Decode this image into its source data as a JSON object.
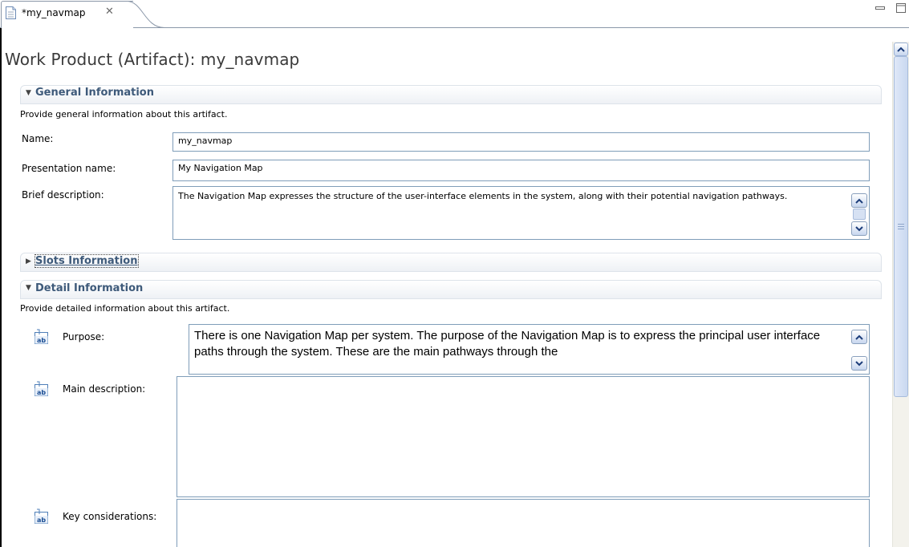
{
  "tab": {
    "label": "*my_navmap",
    "close": "✕"
  },
  "page": {
    "title": "Work Product (Artifact): my_navmap"
  },
  "general": {
    "title": "General Information",
    "description": "Provide general information about this artifact.",
    "name_label": "Name:",
    "name_value": "my_navmap",
    "presentation_label": "Presentation name:",
    "presentation_value": "My Navigation Map",
    "brief_label": "Brief description:",
    "brief_value": "The Navigation Map expresses the structure of the user-interface elements in the system, along with their potential navigation pathways."
  },
  "slots": {
    "title": "Slots Information"
  },
  "detail": {
    "title": "Detail Information",
    "description": "Provide detailed information about this artifact.",
    "purpose_label": "Purpose:",
    "purpose_value": "There is one Navigation Map per system. The purpose of the Navigation Map is to express the principal user interface paths through the system. These are the main pathways through the",
    "main_label": "Main description:",
    "main_value": "",
    "key_label": "Key considerations:",
    "key_value": ""
  },
  "icons": {
    "tab": "document-icon",
    "close": "close-icon",
    "minimize": "minimize-icon",
    "maximize": "maximize-icon",
    "rich_text": "rich-text-editor-icon",
    "expanded": "twisty-expanded-icon",
    "collapsed": "twisty-collapsed-icon"
  },
  "colors": {
    "section_title": "#3e5a7a",
    "field_border": "#7f9db9",
    "scroll_button": "#c7d6ef"
  }
}
